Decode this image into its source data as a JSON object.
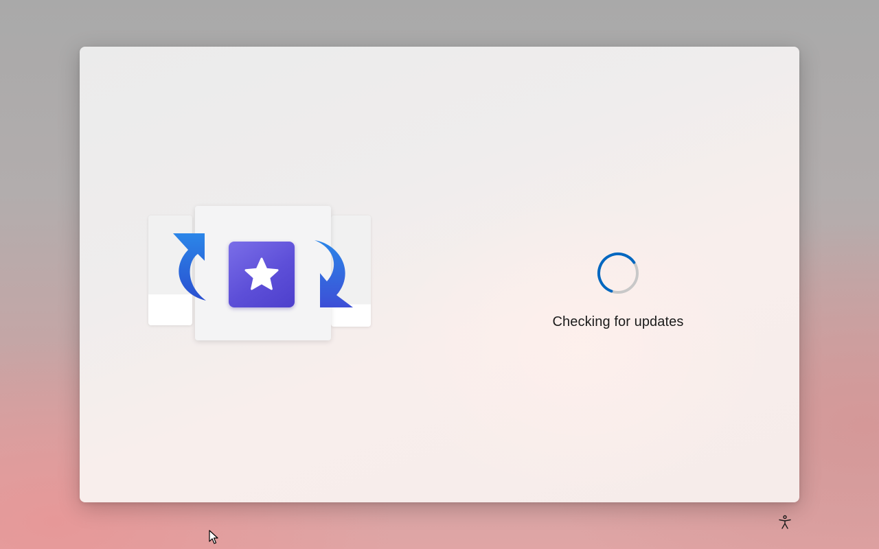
{
  "status": {
    "message": "Checking for updates",
    "spinner_progress": 0.6
  },
  "icons": {
    "app": "star-icon",
    "left_arrow": "refresh-arrow-left-icon",
    "right_arrow": "refresh-arrow-right-icon",
    "accessibility": "accessibility-icon",
    "cursor": "mouse-pointer-icon"
  },
  "colors": {
    "accent": "#0067c0",
    "app_tile": "#5d4fd8",
    "arrow": "#1f63d6",
    "spinner_track": "#c8c8c8"
  }
}
